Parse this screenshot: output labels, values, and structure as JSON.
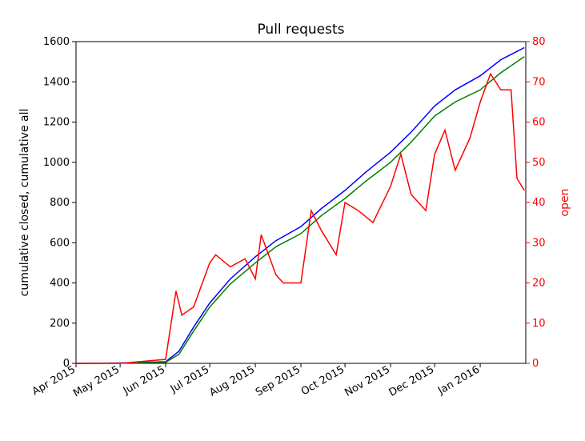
{
  "chart_data": {
    "type": "line",
    "title": "Pull requests",
    "xlabel": "",
    "ylabel_left": "cumulative closed, cumulative all",
    "ylabel_right": "open",
    "categories": [
      "Apr 2015",
      "May 2015",
      "Jun 2015",
      "Jul 2015",
      "Aug 2015",
      "Sep 2015",
      "Oct 2015",
      "Nov 2015",
      "Dec 2015",
      "Jan 2016"
    ],
    "ylim_left": [
      0,
      1600
    ],
    "ylim_right": [
      0,
      80
    ],
    "yticks_left": [
      0,
      200,
      400,
      600,
      800,
      1000,
      1200,
      1400,
      1600
    ],
    "yticks_right": [
      0,
      10,
      20,
      30,
      40,
      50,
      60,
      70,
      80
    ],
    "series": [
      {
        "name": "cumulative all",
        "color": "#0000ff",
        "axis": "left",
        "x": [
          "Apr 2015",
          "May 2015",
          "Jun 2015",
          "Jun 10 2015",
          "Jun 20 2015",
          "Jul 2015",
          "Jul 15 2015",
          "Aug 2015",
          "Aug 15 2015",
          "Sep 2015",
          "Sep 15 2015",
          "Oct 2015",
          "Oct 15 2015",
          "Nov 2015",
          "Nov 15 2015",
          "Dec 2015",
          "Dec 15 2015",
          "Jan 2016",
          "Jan 15 2016",
          "Jan 31 2016"
        ],
        "values": [
          0,
          2,
          8,
          60,
          180,
          300,
          420,
          530,
          610,
          680,
          770,
          860,
          950,
          1050,
          1150,
          1280,
          1360,
          1430,
          1510,
          1570
        ]
      },
      {
        "name": "cumulative closed",
        "color": "#008000",
        "axis": "left",
        "x": [
          "Apr 2015",
          "May 2015",
          "Jun 2015",
          "Jun 10 2015",
          "Jun 20 2015",
          "Jul 2015",
          "Jul 15 2015",
          "Aug 2015",
          "Aug 15 2015",
          "Sep 2015",
          "Sep 15 2015",
          "Oct 2015",
          "Oct 15 2015",
          "Nov 2015",
          "Nov 15 2015",
          "Dec 2015",
          "Dec 15 2015",
          "Jan 2016",
          "Jan 15 2016",
          "Jan 31 2016"
        ],
        "values": [
          0,
          1,
          5,
          45,
          160,
          280,
          395,
          500,
          580,
          645,
          735,
          820,
          905,
          1000,
          1100,
          1230,
          1300,
          1360,
          1445,
          1525
        ]
      },
      {
        "name": "open",
        "color": "#ff0000",
        "axis": "right",
        "x": [
          "Apr 2015",
          "May 2015",
          "Jun 2015",
          "Jun 8 2015",
          "Jun 12 2015",
          "Jun 20 2015",
          "Jul 2015",
          "Jul 5 2015",
          "Jul 15 2015",
          "Jul 25 2015",
          "Aug 2015",
          "Aug 5 2015",
          "Aug 15 2015",
          "Aug 20 2015",
          "Aug 25 2015",
          "Sep 2015",
          "Sep 8 2015",
          "Sep 15 2015",
          "Sep 25 2015",
          "Oct 2015",
          "Oct 10 2015",
          "Oct 20 2015",
          "Nov 2015",
          "Nov 8 2015",
          "Nov 15 2015",
          "Nov 25 2015",
          "Dec 2015",
          "Dec 8 2015",
          "Dec 15 2015",
          "Dec 25 2015",
          "Jan 2016",
          "Jan 8 2016",
          "Jan 15 2016",
          "Jan 22 2016",
          "Jan 26 2016",
          "Jan 31 2016"
        ],
        "values": [
          0,
          0,
          1,
          18,
          12,
          14,
          25,
          27,
          24,
          26,
          21,
          32,
          22,
          20,
          20,
          20,
          38,
          33,
          27,
          40,
          38,
          35,
          44,
          52,
          42,
          38,
          52,
          58,
          48,
          56,
          65,
          72,
          68,
          68,
          46,
          43
        ]
      }
    ]
  }
}
